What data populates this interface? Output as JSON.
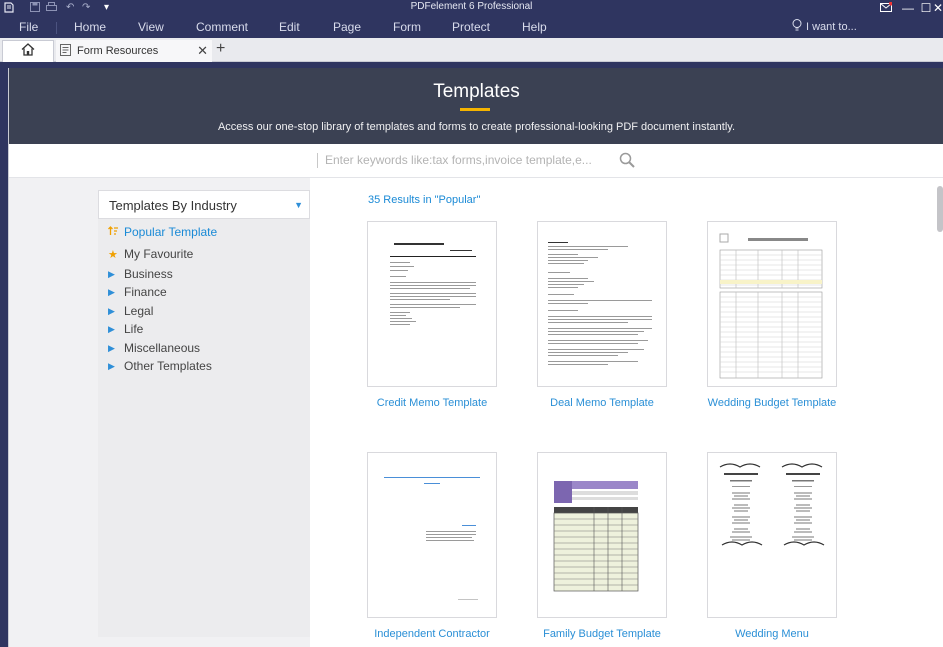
{
  "titlebar": {
    "app_title": "PDFelement 6 Professional"
  },
  "menu": [
    {
      "label": "File"
    },
    {
      "label": "Home"
    },
    {
      "label": "View"
    },
    {
      "label": "Comment"
    },
    {
      "label": "Edit"
    },
    {
      "label": "Page"
    },
    {
      "label": "Form"
    },
    {
      "label": "Protect"
    },
    {
      "label": "Help"
    }
  ],
  "iwant": "I want to...",
  "tabs": {
    "doc_label": "Form Resources"
  },
  "banner": {
    "title": "Templates",
    "subtitle": "Access our one-stop library of templates and forms to create professional-looking PDF document instantly."
  },
  "search": {
    "placeholder": "Enter keywords like:tax forms,invoice template,e..."
  },
  "sidebar": {
    "header": "Templates By Industry",
    "items": [
      {
        "label": "Popular Template",
        "icon": "popular-icon",
        "active": true
      },
      {
        "label": "My Favourite",
        "icon": "star-icon"
      },
      {
        "label": "Business",
        "icon": "chevron-right-icon"
      },
      {
        "label": "Finance",
        "icon": "chevron-right-icon"
      },
      {
        "label": "Legal",
        "icon": "chevron-right-icon"
      },
      {
        "label": "Life",
        "icon": "chevron-right-icon"
      },
      {
        "label": "Miscellaneous",
        "icon": "chevron-right-icon"
      },
      {
        "label": "Other Templates",
        "icon": "chevron-right-icon"
      }
    ]
  },
  "results": "35  Results in \"Popular\"",
  "templates": [
    {
      "title": "Credit Memo Template"
    },
    {
      "title": "Deal Memo Template"
    },
    {
      "title": "Wedding Budget Template"
    },
    {
      "title": "Independent Contractor"
    },
    {
      "title": "Family Budget Template"
    },
    {
      "title": "Wedding Menu"
    }
  ],
  "colors": {
    "titlebar": "#2f3560",
    "banner": "#3b4153",
    "accent": "#f5b400",
    "link": "#2a8fd6"
  }
}
